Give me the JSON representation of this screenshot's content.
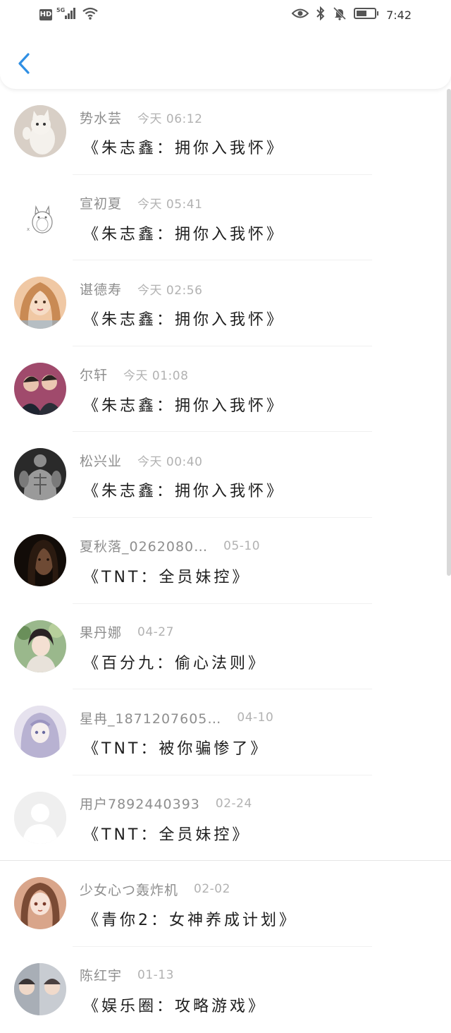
{
  "status_bar": {
    "hd": "HD",
    "network": "5G",
    "time": "7:42"
  },
  "header": {
    "back_icon": "chevron-left-icon"
  },
  "items": [
    {
      "name": "势水芸",
      "date": "今天 06:12",
      "title": "《朱志鑫：拥你入我怀》",
      "avatar": "cat"
    },
    {
      "name": "宣初夏",
      "date": "今天 05:41",
      "title": "《朱志鑫：拥你入我怀》",
      "avatar": "totoro"
    },
    {
      "name": "谌德寿",
      "date": "今天 02:56",
      "title": "《朱志鑫：拥你入我怀》",
      "avatar": "girl"
    },
    {
      "name": "尔轩",
      "date": "今天 01:08",
      "title": "《朱志鑫：拥你入我怀》",
      "avatar": "duo"
    },
    {
      "name": "松兴业",
      "date": "今天 00:40",
      "title": "《朱志鑫：拥你入我怀》",
      "avatar": "muscle"
    },
    {
      "name": "夏秋落_0262080…",
      "date": "05-10",
      "title": "《TNT：全员妹控》",
      "avatar": "dark"
    },
    {
      "name": "果丹娜",
      "date": "04-27",
      "title": "《百分九：偷心法则》",
      "avatar": "anime1"
    },
    {
      "name": "星冉_1871207605…",
      "date": "04-10",
      "title": "《TNT：被你骗惨了》",
      "avatar": "anime2"
    },
    {
      "name": "用户7892440393",
      "date": "02-24",
      "title": "《TNT：全员妹控》",
      "avatar": "default"
    },
    {
      "name": "少女心つ轰炸机",
      "date": "02-02",
      "title": "《青你2：女神养成计划》",
      "avatar": "anime3"
    },
    {
      "name": "陈红宇",
      "date": "01-13",
      "title": "《娱乐圈：攻略游戏》",
      "avatar": "pair"
    }
  ]
}
